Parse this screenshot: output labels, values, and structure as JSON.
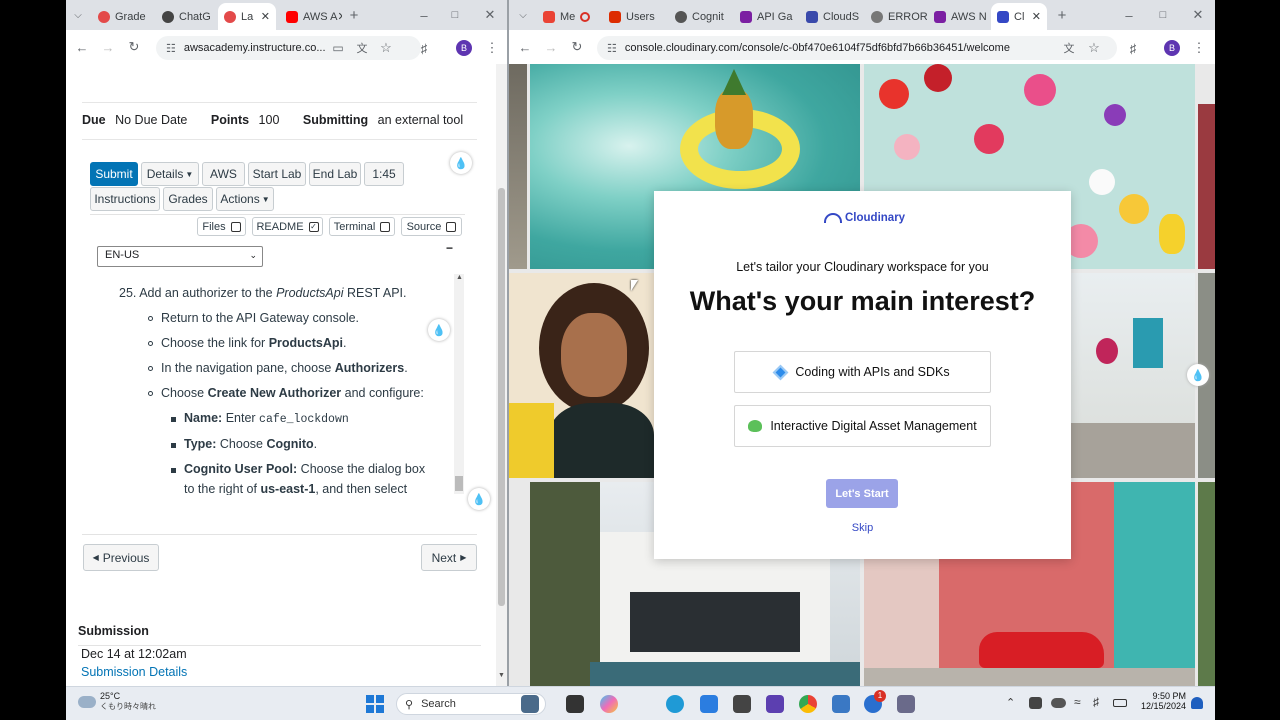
{
  "left_window": {
    "tabs": [
      {
        "label": "Grade",
        "color": "#e34a4a"
      },
      {
        "label": "ChatG",
        "color": "#444444"
      },
      {
        "label": "La",
        "color": "#e34a4a"
      },
      {
        "label": "AWS A",
        "color": "#ff0000"
      }
    ],
    "url": "awsacademy.instructure.co...",
    "avatar": "B",
    "meta": {
      "due_label": "Due",
      "due_value": "No Due Date",
      "points_label": "Points",
      "points_value": "100",
      "submitting_label": "Submitting",
      "submitting_value": "an external tool"
    },
    "lab_buttons": {
      "submit": "Submit",
      "details": "Details",
      "aws": "AWS",
      "start_lab": "Start Lab",
      "end_lab": "End Lab",
      "timer": "1:45",
      "instructions": "Instructions",
      "grades": "Grades",
      "actions": "Actions"
    },
    "toggles": {
      "files": "Files",
      "readme": "README",
      "terminal": "Terminal",
      "source": "Source"
    },
    "language": "EN-US",
    "collapse": "−",
    "instructions": {
      "step_number": "25.",
      "step_pre": "Add an authorizer to the ",
      "step_em": "ProductsApi",
      "step_post": " REST API.",
      "b1": "Return to the API Gateway console.",
      "b2_pre": "Choose the link for ",
      "b2_bold": "ProductsApi",
      "b2_post": ".",
      "b3_pre": "In the navigation pane, choose ",
      "b3_bold": "Authorizers",
      "b3_post": ".",
      "b4_pre": "Choose ",
      "b4_bold": "Create New Authorizer",
      "b4_post": " and configure:",
      "s1_bold": "Name:",
      "s1_pre": " Enter ",
      "s1_code": "cafe_lockdown",
      "s2_bold": "Type:",
      "s2_pre": " Choose ",
      "s2_bold2": "Cognito",
      "s2_post": ".",
      "s3_bold": "Cognito User Pool:",
      "s3_text": " Choose the dialog box",
      "s3_line2_pre": "to the right of ",
      "s3_line2_bold": "us-east-1",
      "s3_line2_post": ", and then select"
    },
    "nav": {
      "previous": "Previous",
      "next": "Next"
    },
    "submission": {
      "heading": "Submission",
      "date": "Dec 14 at 12:02am",
      "details_link": "Submission Details"
    }
  },
  "right_window": {
    "tabs": [
      {
        "label": "Me",
        "color": "#ea4335"
      },
      {
        "label": "Users",
        "color": "#dd2c00"
      },
      {
        "label": "Cognit",
        "color": "#555555"
      },
      {
        "label": "API Ga",
        "color": "#7b1fa2"
      },
      {
        "label": "CloudS",
        "color": "#3949ab"
      },
      {
        "label": "ERROR",
        "color": "#777777"
      },
      {
        "label": "AWS N",
        "color": "#7b1fa2"
      },
      {
        "label": "Cl",
        "color": "#3448c5"
      }
    ],
    "url": "console.cloudinary.com/console/c-0bf470e6104f75df6bfd7b66b36451/welcome",
    "avatar": "B",
    "modal": {
      "brand": "Cloudinary",
      "subtitle": "Let's tailor your Cloudinary workspace for you",
      "title": "What's your main interest?",
      "option1": "Coding with APIs and SDKs",
      "option2": "Interactive Digital Asset Management",
      "start": "Let's Start",
      "skip": "Skip"
    }
  },
  "taskbar": {
    "temperature": "25°C",
    "weather": "くもり時々晴れ",
    "search": "Search",
    "time": "9:50 PM",
    "date": "12/15/2024",
    "badge": "1"
  },
  "colors": {
    "canvas_blue": "#0374b5",
    "cloudinary_blue": "#3448c5",
    "start_button": "#9ba3e8"
  }
}
